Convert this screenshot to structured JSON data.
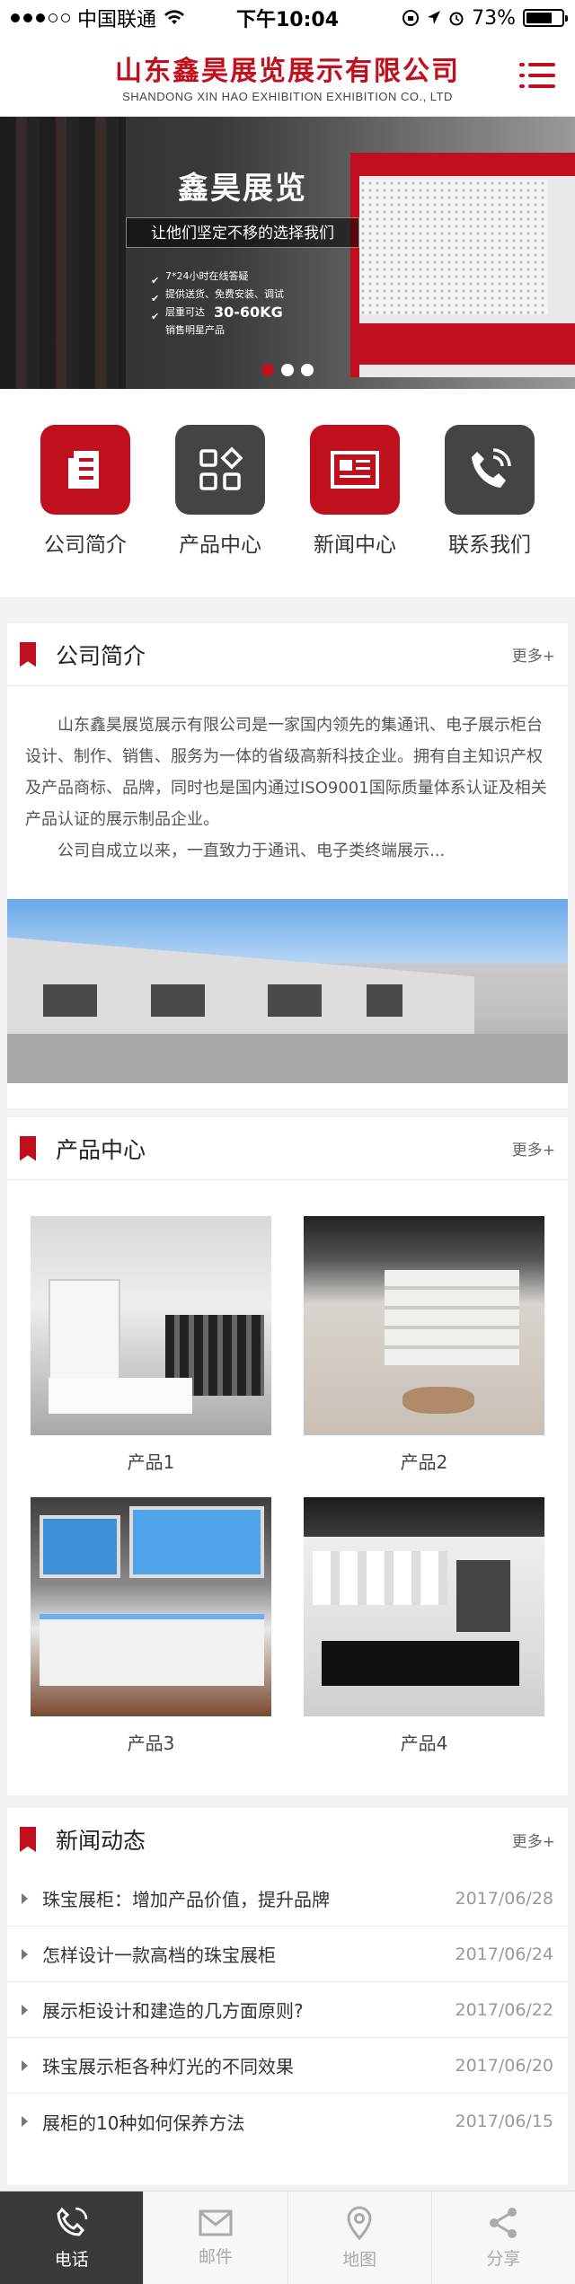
{
  "status_bar": {
    "carrier": "中国联通",
    "time": "下午10:04",
    "battery": "73%",
    "battery_level": 0.73
  },
  "header": {
    "title_cn": "山东鑫昊展览展示有限公司",
    "title_en": "SHANDONG XIN HAO EXHIBITION EXHIBITION CO., LTD"
  },
  "banner": {
    "title": "鑫昊展览",
    "subtitle": "让他们坚定不移的选择我们",
    "points": [
      {
        "text": "7*24小时在线答疑"
      },
      {
        "text": "提供送货、免费安装、调试"
      },
      {
        "text": "层重可达",
        "highlight": "30-60KG"
      }
    ],
    "tail": "销售明星产品",
    "slides": 3,
    "active_slide": 0
  },
  "quicknav": [
    {
      "label": "公司简介",
      "icon": "document-icon"
    },
    {
      "label": "产品中心",
      "icon": "grid-icon"
    },
    {
      "label": "新闻中心",
      "icon": "newspaper-icon"
    },
    {
      "label": "联系我们",
      "icon": "phone-icon"
    }
  ],
  "about": {
    "title": "公司简介",
    "more": "更多+",
    "paragraph1": "山东鑫昊展览展示有限公司是一家国内领先的集通讯、电子展示柜台设计、制作、销售、服务为一体的省级高新科技企业。拥有自主知识产权及产品商标、品牌，同时也是国内通过ISO9001国际质量体系认证及相关产品认证的展示制品企业。",
    "paragraph2": "公司自成立以来，一直致力于通讯、电子类终端展示..."
  },
  "products": {
    "title": "产品中心",
    "more": "更多+",
    "items": [
      {
        "name": "产品1"
      },
      {
        "name": "产品2"
      },
      {
        "name": "产品3"
      },
      {
        "name": "产品4"
      }
    ]
  },
  "news": {
    "title": "新闻动态",
    "more": "更多+",
    "items": [
      {
        "title": "珠宝展柜：增加产品价值，提升品牌",
        "date": "2017/06/28"
      },
      {
        "title": "怎样设计一款高档的珠宝展柜",
        "date": "2017/06/24"
      },
      {
        "title": "展示柜设计和建造的几方面原则?",
        "date": "2017/06/22"
      },
      {
        "title": "珠宝展示柜各种灯光的不同效果",
        "date": "2017/06/20"
      },
      {
        "title": "展柜的10种如何保养方法",
        "date": "2017/06/15"
      }
    ]
  },
  "tabbar": [
    {
      "label": "电话",
      "icon": "phone-icon",
      "active": true
    },
    {
      "label": "邮件",
      "icon": "mail-icon",
      "active": false
    },
    {
      "label": "地图",
      "icon": "map-pin-icon",
      "active": false
    },
    {
      "label": "分享",
      "icon": "share-icon",
      "active": false
    }
  ]
}
